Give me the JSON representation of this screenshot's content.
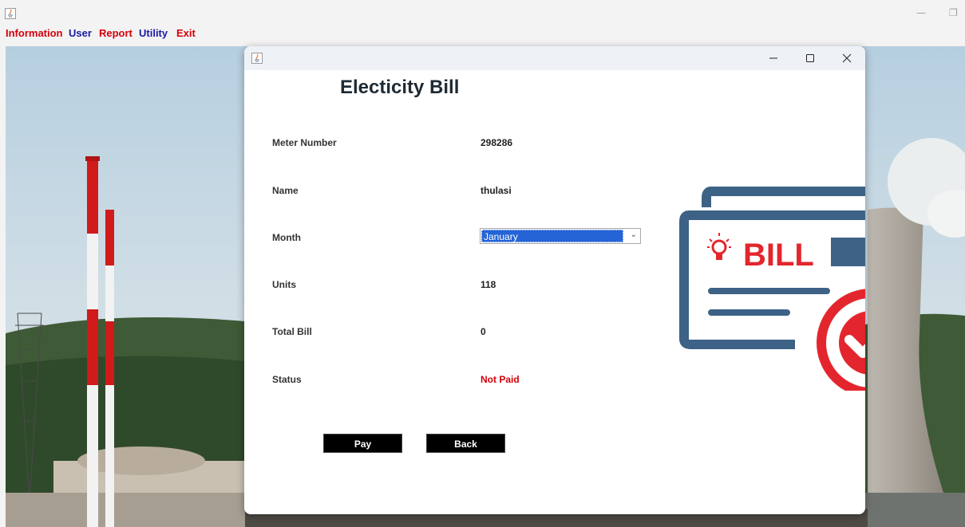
{
  "menu": {
    "items": [
      {
        "label": "Information",
        "color": "#d4000a"
      },
      {
        "label": "User",
        "color": "#1a1aa8"
      },
      {
        "label": "Report",
        "color": "#d4000a"
      },
      {
        "label": "Utility",
        "color": "#1a1aa8"
      },
      {
        "label": "Exit",
        "color": "#d4000a"
      }
    ]
  },
  "dialog": {
    "title": "Electicity Bill",
    "fields": {
      "meter_number": {
        "label": "Meter Number",
        "value": "298286"
      },
      "name": {
        "label": "Name",
        "value": "thulasi"
      },
      "month": {
        "label": "Month",
        "value": "January"
      },
      "units": {
        "label": "Units",
        "value": "118"
      },
      "total_bill": {
        "label": "Total Bill",
        "value": "0"
      },
      "status": {
        "label": "Status",
        "value": "Not Paid"
      }
    },
    "buttons": {
      "pay": "Pay",
      "back": "Back"
    },
    "graphic_text": "BILL"
  },
  "colors": {
    "accent_red": "#d4000a",
    "accent_blue": "#1a1aa8",
    "bill_blue": "#3d6286",
    "bill_red": "#e3262d",
    "selection_blue": "#2464d6"
  }
}
